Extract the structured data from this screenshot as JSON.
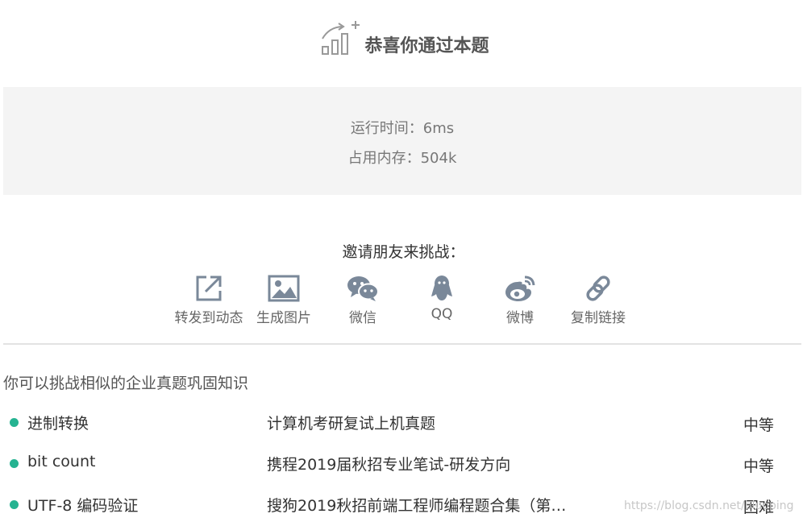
{
  "header": {
    "title": "恭喜你通过本题"
  },
  "stats": {
    "runtime": "运行时间：6ms",
    "memory": "占用内存：504k"
  },
  "invite": {
    "text": "邀请朋友来挑战："
  },
  "share": [
    {
      "label": "转发到动态",
      "icon": "share-arrow-icon"
    },
    {
      "label": "生成图片",
      "icon": "image-icon"
    },
    {
      "label": "微信",
      "icon": "wechat-icon"
    },
    {
      "label": "QQ",
      "icon": "qq-penguin-icon"
    },
    {
      "label": "微博",
      "icon": "weibo-icon"
    },
    {
      "label": "复制链接",
      "icon": "link-icon"
    }
  ],
  "similar": {
    "title": "你可以挑战相似的企业真题巩固知识",
    "items": [
      {
        "name": "进制转换",
        "source": "计算机考研复试上机真题",
        "level": "中等"
      },
      {
        "name": "bit count",
        "source": "携程2019届秋招专业笔试-研发方向",
        "level": "中等"
      },
      {
        "name": "UTF-8 编码验证",
        "source": "搜狗2019秋招前端工程师编程题合集（第…",
        "level": "困难"
      }
    ]
  },
  "watermark": "https://blog.csdn.net/bluoping",
  "colors": {
    "accent": "#25b391",
    "icon": "#7a8899",
    "panel": "#f4f4f4"
  }
}
